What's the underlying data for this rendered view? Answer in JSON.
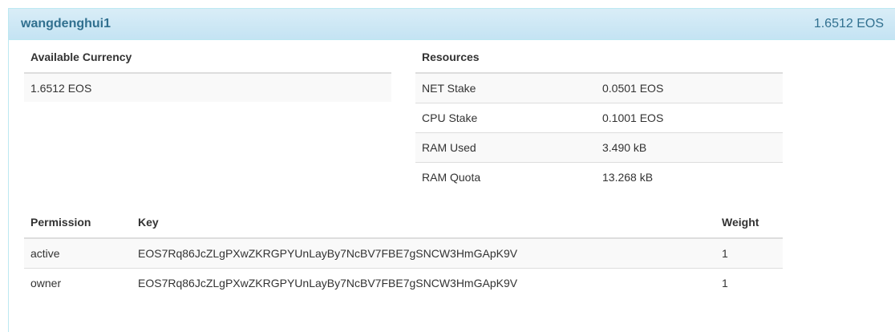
{
  "header": {
    "account_name": "wangdenghui1",
    "balance": "1.6512 EOS"
  },
  "currency": {
    "title": "Available Currency",
    "value": "1.6512 EOS"
  },
  "resources": {
    "title": "Resources",
    "rows": [
      {
        "label": "NET Stake",
        "value": "0.0501 EOS"
      },
      {
        "label": "CPU Stake",
        "value": "0.1001 EOS"
      },
      {
        "label": "RAM Used",
        "value": "3.490 kB"
      },
      {
        "label": "RAM Quota",
        "value": "13.268 kB"
      }
    ]
  },
  "permissions": {
    "columns": [
      "Permission",
      "Key",
      "Weight"
    ],
    "rows": [
      {
        "permission": "active",
        "key": "EOS7Rq86JcZLgPXwZKRGPYUnLayBy7NcBV7FBE7gSNCW3HmGApK9V",
        "weight": "1"
      },
      {
        "permission": "owner",
        "key": "EOS7Rq86JcZLgPXwZKRGPYUnLayBy7NcBV7FBE7gSNCW3HmGApK9V",
        "weight": "1"
      }
    ]
  }
}
